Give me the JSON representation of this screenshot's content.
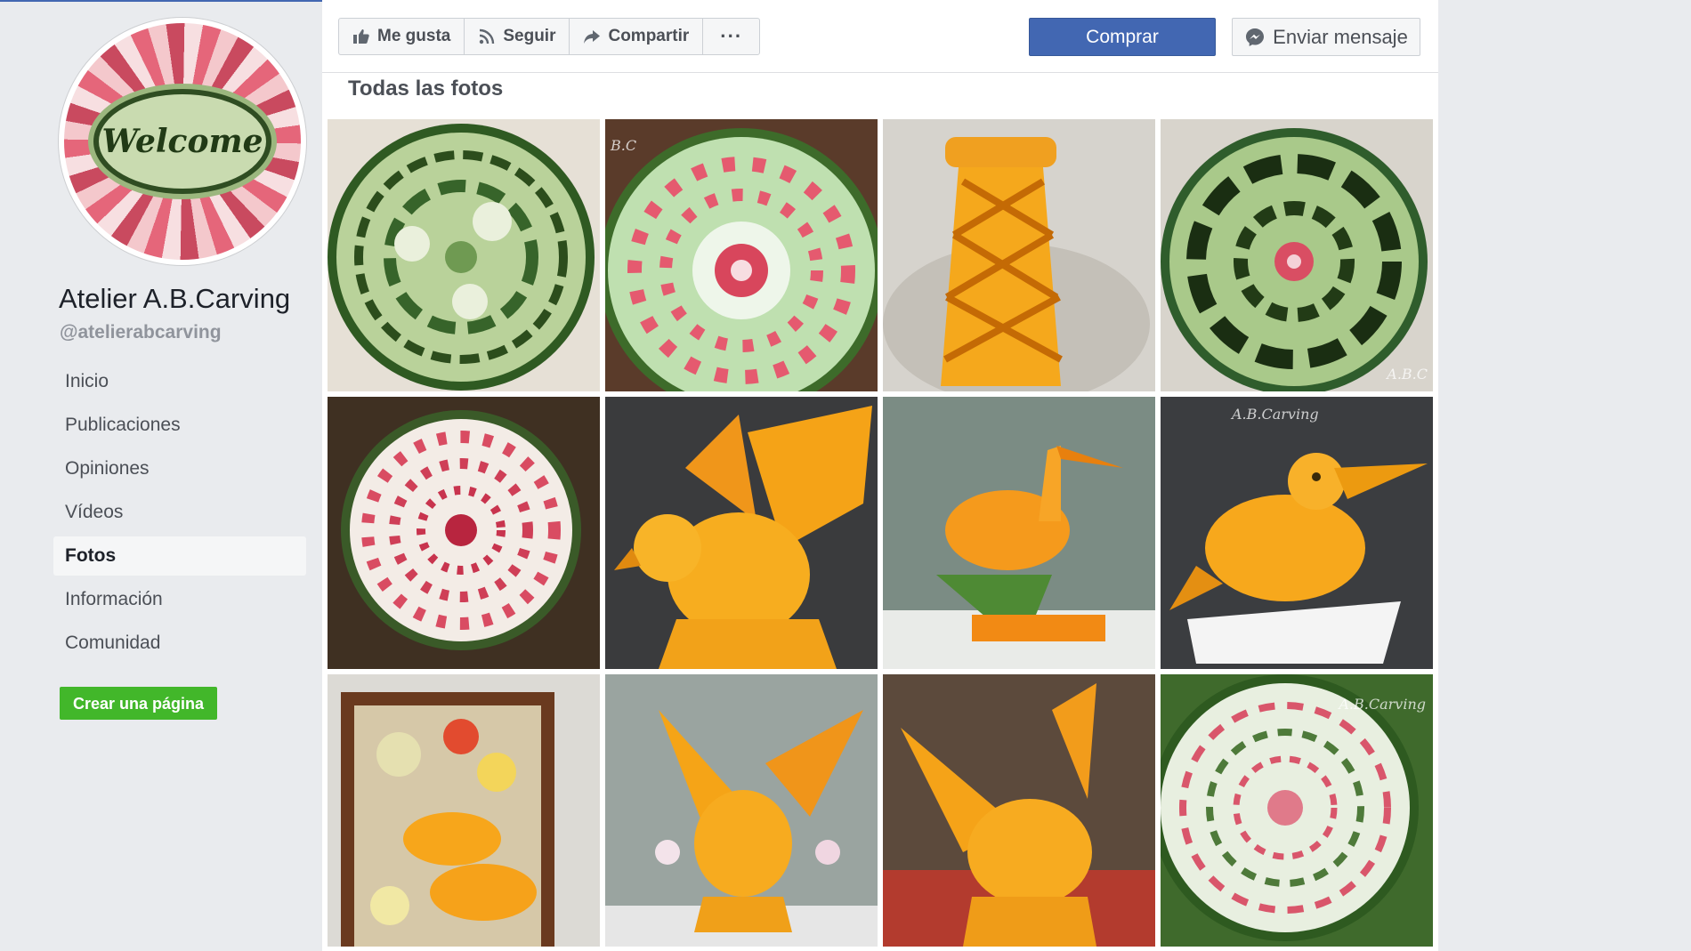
{
  "page": {
    "name": "Atelier A.B.Carving",
    "handle": "@atelierabcarving",
    "avatar_text": "Welcome"
  },
  "nav": {
    "items": [
      {
        "label": "Inicio"
      },
      {
        "label": "Publicaciones"
      },
      {
        "label": "Opiniones"
      },
      {
        "label": "Vídeos"
      },
      {
        "label": "Fotos",
        "active": true
      },
      {
        "label": "Información"
      },
      {
        "label": "Comunidad"
      }
    ],
    "create_page": "Crear una página"
  },
  "actions": {
    "like": "Me gusta",
    "follow": "Seguir",
    "share": "Compartir",
    "more": "···",
    "buy": "Comprar",
    "message": "Enviar mensaje"
  },
  "photos": {
    "title": "Todas las fotos",
    "items": [
      {
        "icon": "watermelon-green-swirl-carving-photo"
      },
      {
        "icon": "watermelon-pink-rose-carving-photo"
      },
      {
        "icon": "orange-lattice-vase-carving-photo"
      },
      {
        "icon": "watermelon-dark-floral-carving-photo"
      },
      {
        "icon": "watermelon-dahlia-carving-photo"
      },
      {
        "icon": "orange-eagle-carving-photo"
      },
      {
        "icon": "orange-heron-carving-photo"
      },
      {
        "icon": "orange-toucan-carving-photo"
      },
      {
        "icon": "fruit-fish-arrangement-photo"
      },
      {
        "icon": "orange-bird-flowers-carving-photo"
      },
      {
        "icon": "orange-phoenix-carving-photo"
      },
      {
        "icon": "watermelon-spiral-carving-photo"
      }
    ]
  },
  "colors": {
    "brand_blue": "#4267b2",
    "create_green": "#42b72a",
    "background": "#e9ebee"
  }
}
